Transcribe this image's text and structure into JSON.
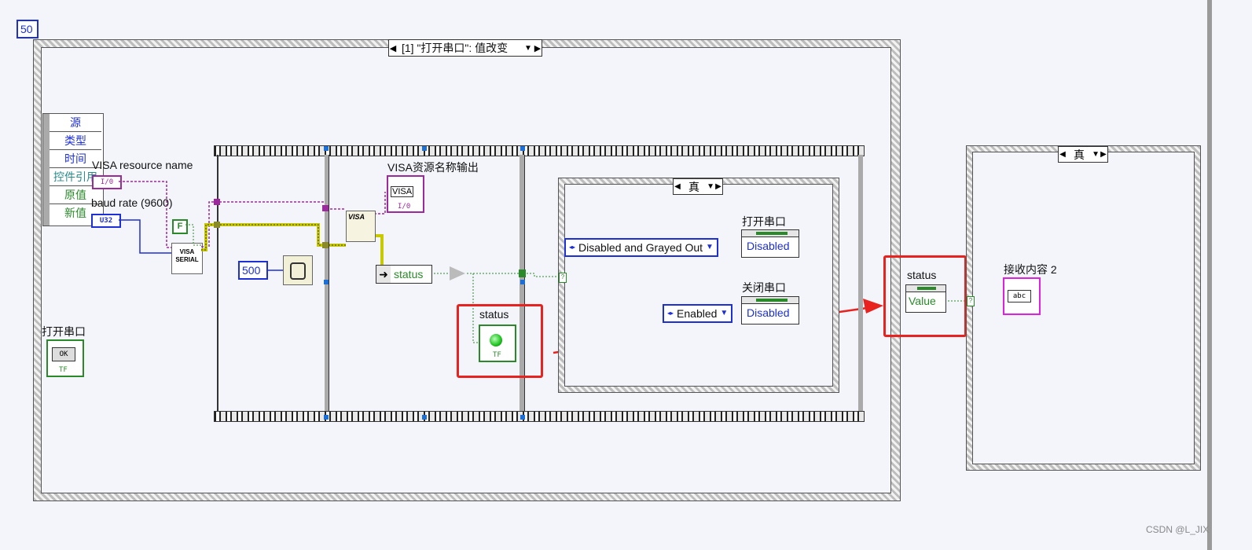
{
  "loop_timeout": "50",
  "event_case_selector": "[1] \"打开串口\": 值改变",
  "event_data_nodes": [
    "源",
    "类型",
    "时间",
    "控件引用",
    "原值",
    "新值"
  ],
  "visa_resource_label": "VISA resource name",
  "visa_resource_terminal": "I/0",
  "baud_rate_label": "baud rate (9600)",
  "baud_rate_terminal": "U32",
  "false_const": "F",
  "visa_serial_node": "VISA SERIAL",
  "wait_const": "500",
  "visa_out_label": "VISA资源名称输出",
  "visa_out_terminal": "VISA",
  "visa_out_type": "I/0",
  "status_unbundle": "status",
  "status_indicator_label": "status",
  "status_indicator_type": "TF",
  "inner_case_selector": "真",
  "open_port_label_top": "打开串口",
  "disabled_enum": "Disabled and Grayed Out",
  "disabled_prop_1": "Disabled",
  "close_port_label": "关闭串口",
  "enabled_enum": "Enabled",
  "disabled_prop_2": "Disabled",
  "status_prop_label": "status",
  "status_prop_value": "Value",
  "open_port_button_label": "打开串口",
  "open_button_text": "OK",
  "open_button_type": "TF",
  "right_case_selector": "真",
  "receive_label": "接收内容 2",
  "receive_terminal": "abc",
  "watermark": "CSDN @L_JIX",
  "colors": {
    "accent_blue": "#1d2fd6",
    "wire_green": "#2a8a2a",
    "annotation_red": "#e8231f",
    "visa_purple": "#9c2a9c"
  }
}
